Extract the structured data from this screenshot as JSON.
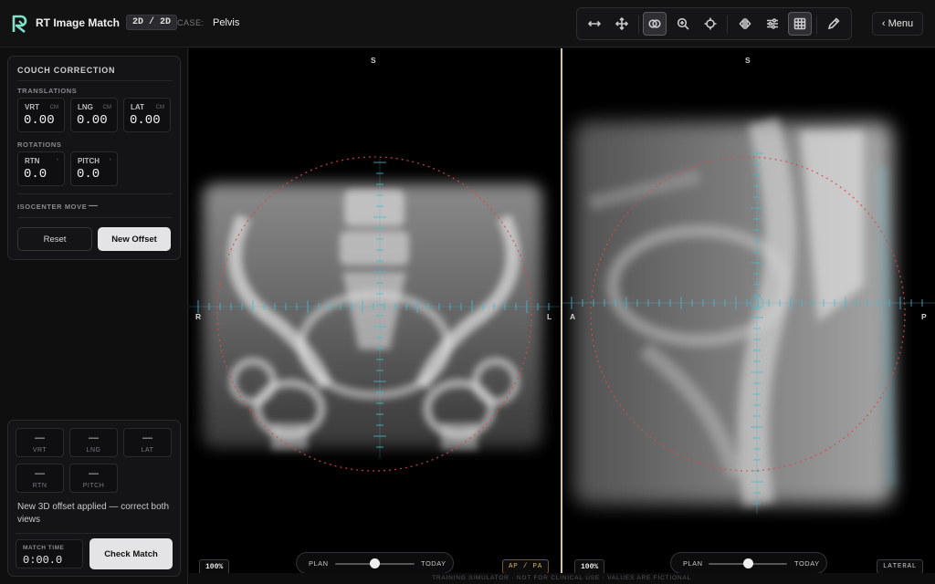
{
  "header": {
    "app_title": "RT Image Match",
    "mode": "2D / 2D",
    "case_label": "CASE:",
    "case_value": "Pelvis",
    "menu_label": "‹ Menu",
    "tools": [
      "horizontal-arrows-icon",
      "move-icon",
      "overlay-icon",
      "zoom-icon",
      "crosshair-icon",
      "flip-icon",
      "sliders-icon",
      "grid-icon",
      "pencil-icon"
    ]
  },
  "couch": {
    "title": "COUCH CORRECTION",
    "translations_label": "TRANSLATIONS",
    "translations": [
      {
        "label": "VRT",
        "unit": "CM",
        "value": "0.00"
      },
      {
        "label": "LNG",
        "unit": "CM",
        "value": "0.00"
      },
      {
        "label": "LAT",
        "unit": "CM",
        "value": "0.00"
      }
    ],
    "rotations_label": "ROTATIONS",
    "rotations": [
      {
        "label": "RTN",
        "unit": "°",
        "value": "0.0"
      },
      {
        "label": "PITCH",
        "unit": "°",
        "value": "0.0"
      }
    ],
    "isocenter_label": "ISOCENTER MOVE",
    "isocenter_value": "—",
    "reset_label": "Reset",
    "new_offset_label": "New Offset"
  },
  "result": {
    "cells": [
      {
        "label": "VRT",
        "value": "—"
      },
      {
        "label": "LNG",
        "value": "—"
      },
      {
        "label": "LAT",
        "value": "—"
      },
      {
        "label": "RTN",
        "value": "—"
      },
      {
        "label": "PITCH",
        "value": "—"
      }
    ],
    "message": "New 3D offset applied — correct both views",
    "match_time_label": "MATCH TIME",
    "match_time_value": "0:00.0",
    "check_match_label": "Check Match"
  },
  "viewer_ap": {
    "top": "S",
    "left": "R",
    "right": "L",
    "zoom": "100%",
    "plan": "PLAN",
    "today": "TODAY",
    "blend": 0.5,
    "projection": "AP / PA",
    "projection_color": "#d9b45a"
  },
  "viewer_lat": {
    "top": "S",
    "left": "A",
    "right": "P",
    "zoom": "100%",
    "plan": "PLAN",
    "today": "TODAY",
    "blend": 0.5,
    "projection": "LATERAL",
    "projection_color": "#c8c8cc"
  },
  "footer": "TRAINING SIMULATOR · NOT FOR CLINICAL USE · VALUES ARE FICTIONAL"
}
